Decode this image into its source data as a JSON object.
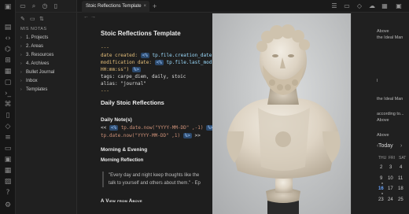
{
  "tab": {
    "title": "Stoic Reflections Template",
    "close": "×",
    "new": "+"
  },
  "sidebar": {
    "vault_name": "MIS NOTAS",
    "items": [
      {
        "label": "1. Projects",
        "chevron": "›"
      },
      {
        "label": "2. Areas",
        "chevron": "›"
      },
      {
        "label": "3. Resources",
        "chevron": "›"
      },
      {
        "label": "4. Archives",
        "chevron": "›"
      },
      {
        "label": "Bullet Journal",
        "chevron": "›"
      },
      {
        "label": "Inbox",
        "chevron": "›"
      },
      {
        "label": "Templates",
        "chevron": "›"
      }
    ]
  },
  "editor": {
    "nav": "← →",
    "title": "Stoic Reflections Template",
    "fm_open": "---",
    "l_date_key": "date created:",
    "l_date_pill": "<%",
    "l_date_val": "tp.file.creation_date()",
    "l_mod_key": "modification date:",
    "l_mod_pill": "<%",
    "l_mod_val": "tp.file.last_modif",
    "l_mod_wrap": "HH:mm:ss\")",
    "l_mod_wrap_pill": "%>",
    "l_tags": "tags: carpe_diem, daily, stoic",
    "l_alias_key": "alias:",
    "l_alias_val": "\"journal\"",
    "fm_close": "---",
    "h_daily": "Daily Stoic Reflections",
    "h_note": "Daily Note(s)",
    "l_n1_a": "<< ",
    "l_n1_pill": "<%",
    "l_n1_b": " tp.date.now(\"YYYY-MM-DD\" ,-1) ",
    "l_n1_pill2": "%>",
    "l_n1_c": " |",
    "l_n2_a": "tp.date.now(\"YYYY-MM-DD\" ,1) ",
    "l_n2_pill": "%>",
    "l_n2_b": " >>",
    "h_morning": "Morning & Evening",
    "h_reflection": "Morning Reflection",
    "quote_1": "\"Every day and night keep thoughts like the",
    "quote_2": "talk to yourself and others about them.\" - Ep",
    "view_above": "A View from Above"
  },
  "right": {
    "texts": [
      "Above",
      "the Ideal Man",
      "l",
      "the Ideal Man",
      "according to...",
      "Above",
      "Above"
    ],
    "cal_today": "Today",
    "cal_dow": [
      "THU",
      "FRI",
      "SAT"
    ],
    "cal_days": [
      [
        "2",
        "3",
        "4"
      ],
      [
        "9",
        "10",
        "11"
      ],
      [
        "16",
        "17",
        "18"
      ],
      [
        "23",
        "24",
        "25"
      ]
    ]
  }
}
